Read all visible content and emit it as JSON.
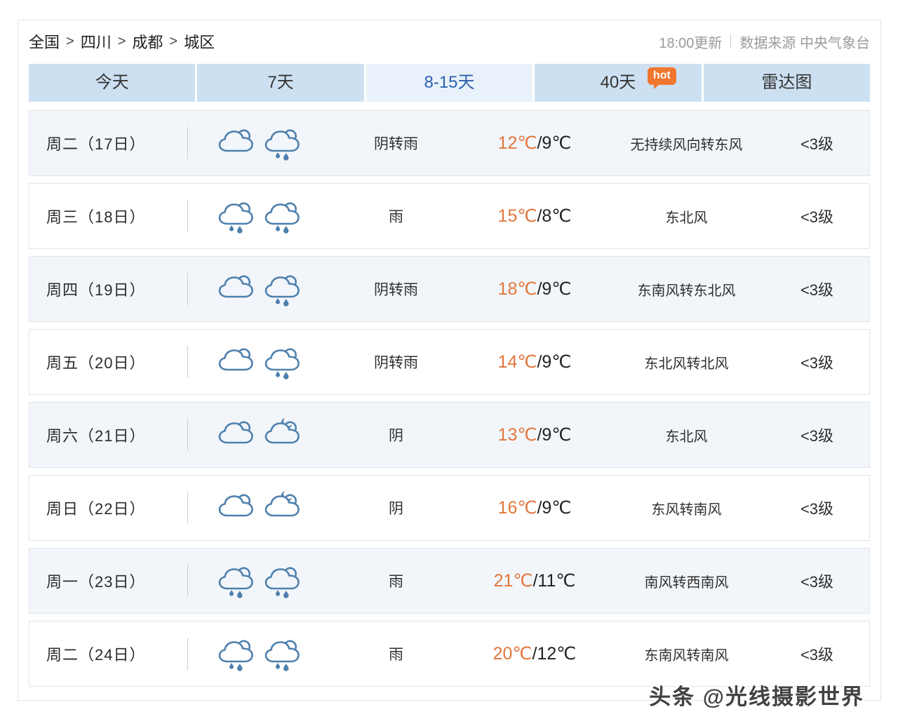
{
  "breadcrumb": {
    "items": [
      "全国",
      "四川",
      "成都",
      "城区"
    ],
    "separator": ">"
  },
  "meta": {
    "update_time": "18:00更新",
    "source": "数据来源 中央气象台"
  },
  "tabs": {
    "items": [
      {
        "label": "今天",
        "active": false
      },
      {
        "label": "7天",
        "active": false
      },
      {
        "label": "8-15天",
        "active": true
      },
      {
        "label": "40天",
        "active": false,
        "badge": "hot"
      },
      {
        "label": "雷达图",
        "active": false
      }
    ]
  },
  "forecast": {
    "temp_separator": "/",
    "rows": [
      {
        "day": "周二（17日）",
        "icons": [
          "overcast",
          "rain"
        ],
        "weather": "阴转雨",
        "temp_high": "12℃",
        "temp_low": "9℃",
        "wind": "无持续风向转东风",
        "wind_level": "<3级"
      },
      {
        "day": "周三（18日）",
        "icons": [
          "rain",
          "rain"
        ],
        "weather": "雨",
        "temp_high": "15℃",
        "temp_low": "8℃",
        "wind": "东北风",
        "wind_level": "<3级"
      },
      {
        "day": "周四（19日）",
        "icons": [
          "overcast",
          "rain"
        ],
        "weather": "阴转雨",
        "temp_high": "18℃",
        "temp_low": "9℃",
        "wind": "东南风转东北风",
        "wind_level": "<3级"
      },
      {
        "day": "周五（20日）",
        "icons": [
          "overcast",
          "rain"
        ],
        "weather": "阴转雨",
        "temp_high": "14℃",
        "temp_low": "9℃",
        "wind": "东北风转北风",
        "wind_level": "<3级"
      },
      {
        "day": "周六（21日）",
        "icons": [
          "overcast",
          "overcast-night"
        ],
        "weather": "阴",
        "temp_high": "13℃",
        "temp_low": "9℃",
        "wind": "东北风",
        "wind_level": "<3级"
      },
      {
        "day": "周日（22日）",
        "icons": [
          "overcast",
          "overcast-night"
        ],
        "weather": "阴",
        "temp_high": "16℃",
        "temp_low": "9℃",
        "wind": "东风转南风",
        "wind_level": "<3级"
      },
      {
        "day": "周一（23日）",
        "icons": [
          "rain",
          "rain"
        ],
        "weather": "雨",
        "temp_high": "21℃",
        "temp_low": "11℃",
        "wind": "南风转西南风",
        "wind_level": "<3级"
      },
      {
        "day": "周二（24日）",
        "icons": [
          "rain",
          "rain"
        ],
        "weather": "雨",
        "temp_high": "20℃",
        "temp_low": "12℃",
        "wind": "东南风转南风",
        "wind_level": "<3级"
      }
    ]
  },
  "watermark": "头条 @光线摄影世界",
  "colors": {
    "accent_orange": "#e2763c",
    "tab_bg": "#cde0f1",
    "tab_active_bg": "#e9f2fa",
    "tab_active_text": "#2b5fae",
    "icon_blue": "#4e80ad",
    "row_alt_bg": "#f2f6fa",
    "border": "#dfe5ea",
    "meta_gray": "#9b9b9b",
    "badge_orange": "#f0772e",
    "text_dark": "#2e2e2e"
  }
}
